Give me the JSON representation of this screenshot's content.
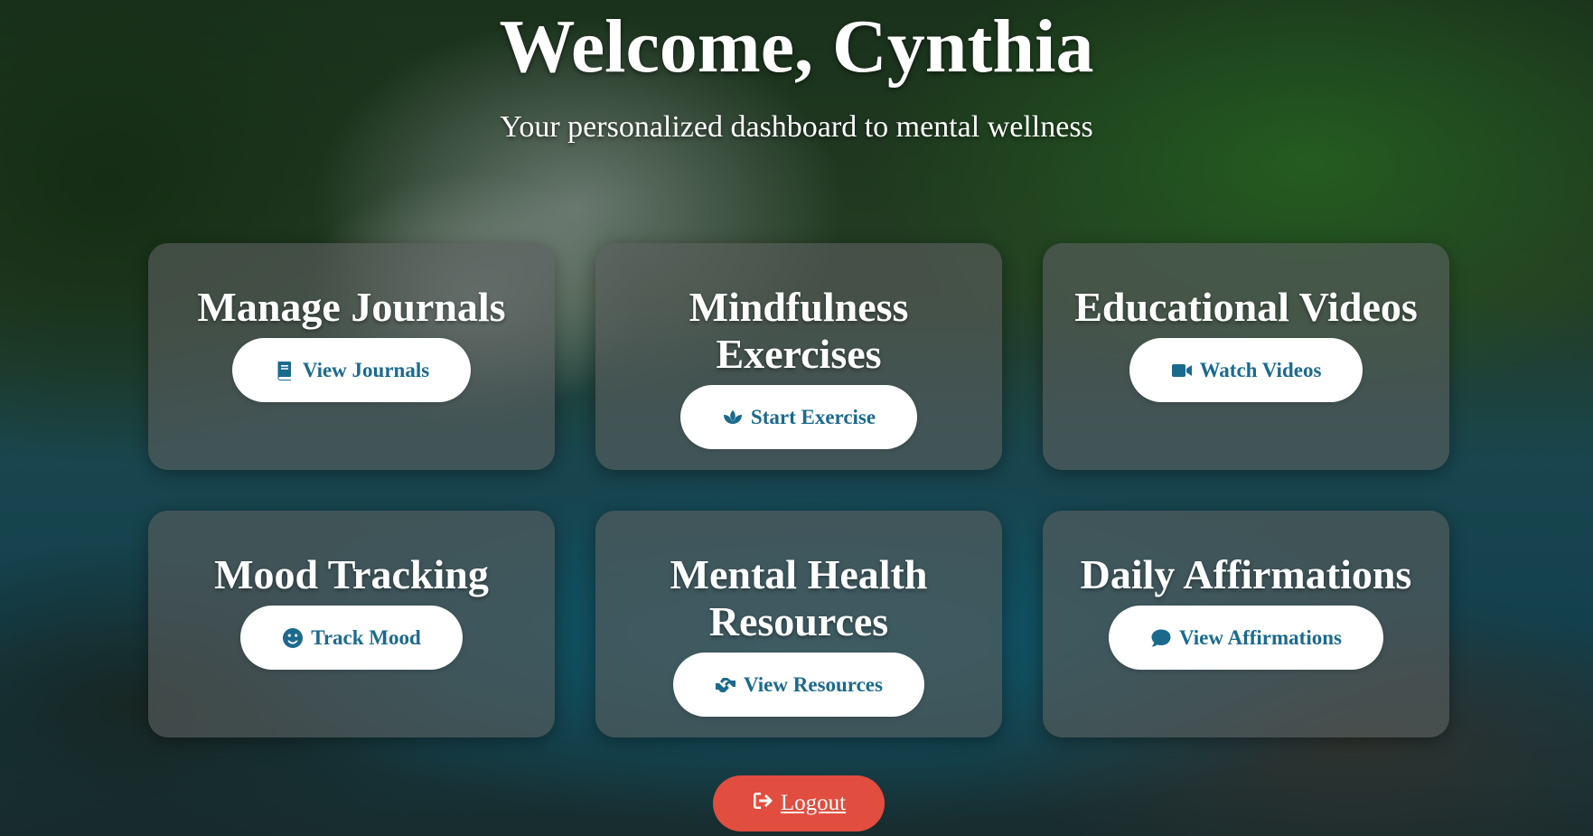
{
  "header": {
    "title": "Welcome, Cynthia",
    "subtitle": "Your personalized dashboard to mental wellness"
  },
  "cards": [
    {
      "title": "Manage Journals",
      "button_label": "View Journals",
      "icon": "book-icon"
    },
    {
      "title": "Mindfulness Exercises",
      "button_label": "Start Exercise",
      "icon": "lotus-icon"
    },
    {
      "title": "Educational Videos",
      "button_label": "Watch Videos",
      "icon": "video-camera-icon"
    },
    {
      "title": "Mood Tracking",
      "button_label": "Track Mood",
      "icon": "smile-icon"
    },
    {
      "title": "Mental Health Resources",
      "button_label": "View Resources",
      "icon": "hands-helping-icon"
    },
    {
      "title": "Daily Affirmations",
      "button_label": "View Affirmations",
      "icon": "comment-icon"
    }
  ],
  "logout": {
    "label": "Logout",
    "icon": "sign-out-icon"
  },
  "colors": {
    "button_text": "#1b6a8e",
    "logout_bg": "#e14d3f"
  }
}
